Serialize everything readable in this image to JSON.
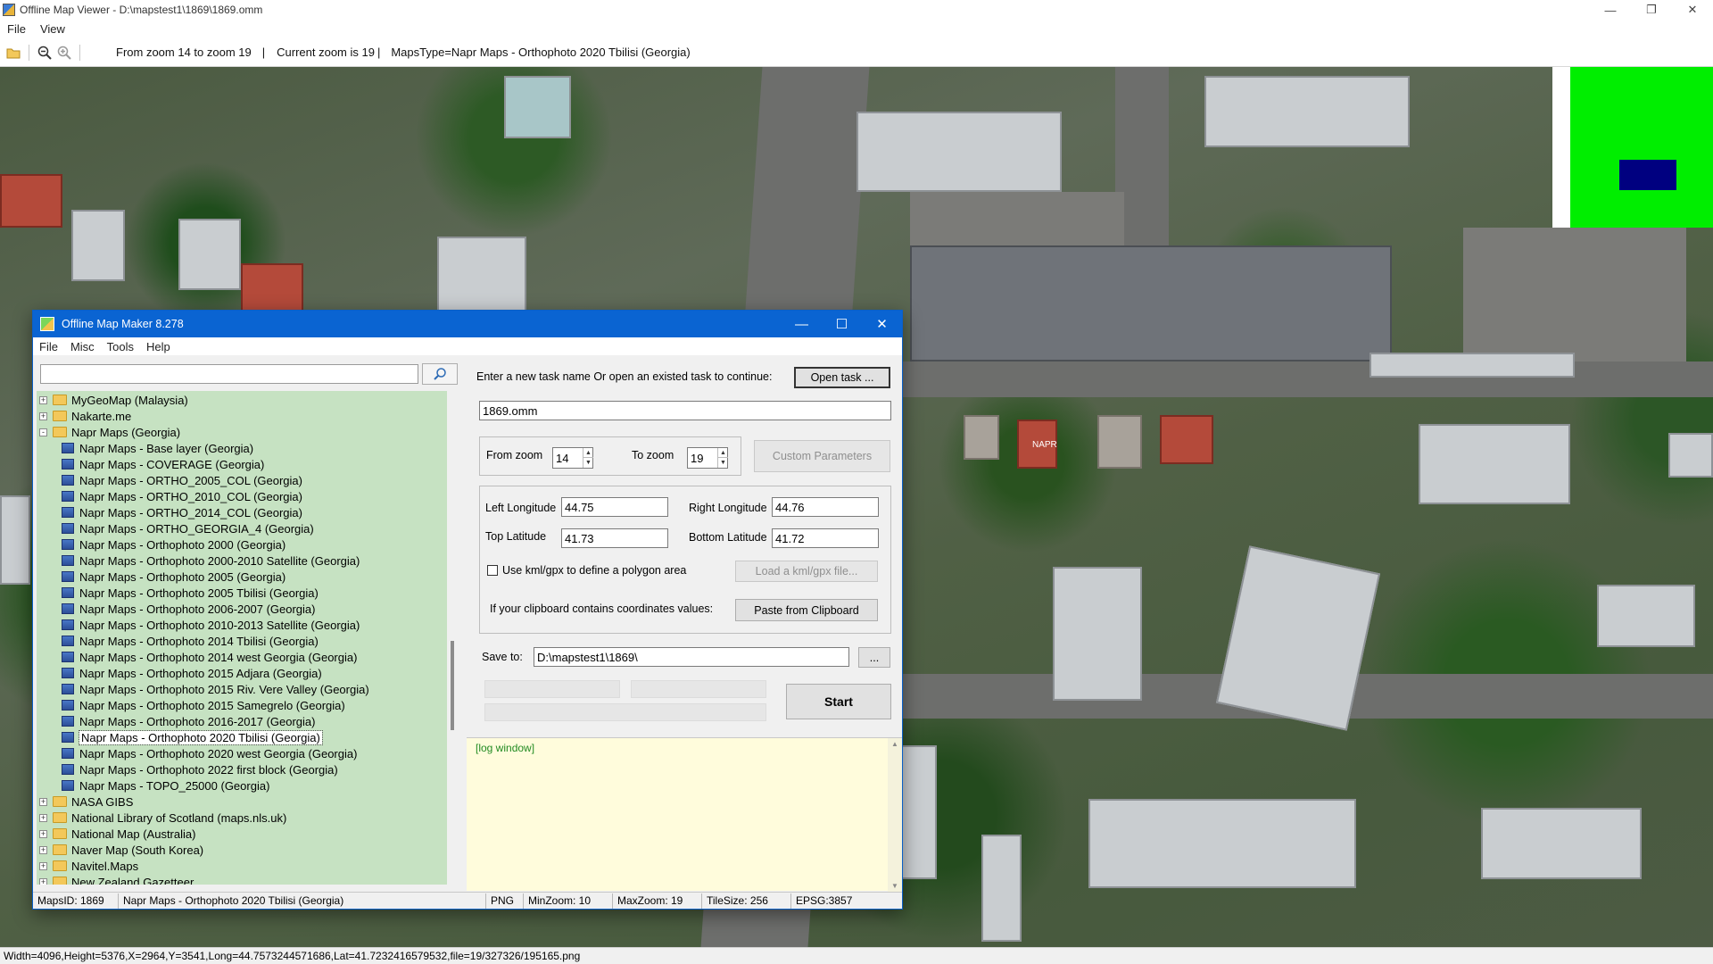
{
  "window": {
    "title": "Offline Map Viewer - D:\\mapstest1\\1869\\1869.omm",
    "menu": [
      "File",
      "View"
    ]
  },
  "toolbar": {
    "zoom_range": "From zoom 14 to zoom 19",
    "sep1": "|",
    "current_zoom": "Current zoom is 19",
    "sep2": "|",
    "maps_type": "MapsType=Napr Maps - Orthophoto 2020 Tbilisi (Georgia)"
  },
  "map": {
    "label": "NAPR"
  },
  "viewer_status": "Width=4096,Height=5376,X=2964,Y=3541,Long=44.7573244571686,Lat=41.7232416579532,file=19/327326/195165.png",
  "dialog": {
    "title": "Offline Map Maker 8.278",
    "menu": [
      "File",
      "Misc",
      "Tools",
      "Help"
    ],
    "search": {
      "value": ""
    },
    "tree": [
      {
        "level": 0,
        "type": "folder",
        "exp": "+",
        "label": "MyGeoMap (Malaysia)"
      },
      {
        "level": 0,
        "type": "folder",
        "exp": "+",
        "label": "Nakarte.me"
      },
      {
        "level": 0,
        "type": "folder",
        "exp": "-",
        "label": "Napr Maps (Georgia)"
      },
      {
        "level": 1,
        "type": "map",
        "label": "Napr Maps - Base layer (Georgia)"
      },
      {
        "level": 1,
        "type": "map",
        "label": "Napr Maps - COVERAGE (Georgia)"
      },
      {
        "level": 1,
        "type": "map",
        "label": "Napr Maps - ORTHO_2005_COL (Georgia)"
      },
      {
        "level": 1,
        "type": "map",
        "label": "Napr Maps - ORTHO_2010_COL (Georgia)"
      },
      {
        "level": 1,
        "type": "map",
        "label": "Napr Maps - ORTHO_2014_COL (Georgia)"
      },
      {
        "level": 1,
        "type": "map",
        "label": "Napr Maps - ORTHO_GEORGIA_4 (Georgia)"
      },
      {
        "level": 1,
        "type": "map",
        "label": "Napr Maps - Orthophoto 2000 (Georgia)"
      },
      {
        "level": 1,
        "type": "map",
        "label": "Napr Maps - Orthophoto 2000-2010 Satellite (Georgia)"
      },
      {
        "level": 1,
        "type": "map",
        "label": "Napr Maps - Orthophoto 2005 (Georgia)"
      },
      {
        "level": 1,
        "type": "map",
        "label": "Napr Maps - Orthophoto 2005 Tbilisi (Georgia)"
      },
      {
        "level": 1,
        "type": "map",
        "label": "Napr Maps - Orthophoto 2006-2007 (Georgia)"
      },
      {
        "level": 1,
        "type": "map",
        "label": "Napr Maps - Orthophoto 2010-2013 Satellite (Georgia)"
      },
      {
        "level": 1,
        "type": "map",
        "label": "Napr Maps - Orthophoto 2014 Tbilisi (Georgia)"
      },
      {
        "level": 1,
        "type": "map",
        "label": "Napr Maps - Orthophoto 2014 west Georgia (Georgia)"
      },
      {
        "level": 1,
        "type": "map",
        "label": "Napr Maps - Orthophoto 2015 Adjara (Georgia)"
      },
      {
        "level": 1,
        "type": "map",
        "label": "Napr Maps - Orthophoto 2015 Riv. Vere Valley (Georgia)"
      },
      {
        "level": 1,
        "type": "map",
        "label": "Napr Maps - Orthophoto 2015 Samegrelo (Georgia)"
      },
      {
        "level": 1,
        "type": "map",
        "label": "Napr Maps - Orthophoto 2016-2017 (Georgia)"
      },
      {
        "level": 1,
        "type": "map",
        "label": "Napr Maps - Orthophoto 2020 Tbilisi (Georgia)",
        "selected": true
      },
      {
        "level": 1,
        "type": "map",
        "label": "Napr Maps - Orthophoto 2020 west Georgia (Georgia)"
      },
      {
        "level": 1,
        "type": "map",
        "label": "Napr Maps - Orthophoto 2022 first block (Georgia)"
      },
      {
        "level": 1,
        "type": "map",
        "label": "Napr Maps - TOPO_25000 (Georgia)"
      },
      {
        "level": 0,
        "type": "folder",
        "exp": "+",
        "label": "NASA GIBS"
      },
      {
        "level": 0,
        "type": "folder",
        "exp": "+",
        "label": "National Library of Scotland (maps.nls.uk)"
      },
      {
        "level": 0,
        "type": "folder",
        "exp": "+",
        "label": "National Map (Australia)"
      },
      {
        "level": 0,
        "type": "folder",
        "exp": "+",
        "label": "Naver Map (South Korea)"
      },
      {
        "level": 0,
        "type": "folder",
        "exp": "+",
        "label": "Navitel.Maps"
      },
      {
        "level": 0,
        "type": "folder",
        "exp": "+",
        "label": "New Zealand Gazetteer"
      }
    ],
    "task_prompt": "Enter a new task name Or open an existed task to continue:",
    "open_task": "Open task ...",
    "task_name": "1869.omm",
    "from_zoom_label": "From zoom",
    "from_zoom": "14",
    "to_zoom_label": "To zoom",
    "to_zoom": "19",
    "custom_params": "Custom Parameters",
    "left_lon_label": "Left Longitude",
    "left_lon": "44.75",
    "right_lon_label": "Right Longitude",
    "right_lon": "44.76",
    "top_lat_label": "Top Latitude",
    "top_lat": "41.73",
    "bottom_lat_label": "Bottom Latitude",
    "bottom_lat": "41.72",
    "kml_label": "Use kml/gpx to define a polygon area",
    "load_kml": "Load a kml/gpx file...",
    "clipboard_prompt": "If your clipboard contains coordinates values:",
    "paste_clipboard": "Paste from Clipboard",
    "save_to_label": "Save to:",
    "save_to": "D:\\mapstest1\\1869\\",
    "browse": "...",
    "start": "Start",
    "log": "[log window]",
    "status": {
      "maps_id": "MapsID: 1869",
      "maps_name": "Napr Maps - Orthophoto 2020 Tbilisi (Georgia)",
      "format": "PNG",
      "min_zoom": "MinZoom: 10",
      "max_zoom": "MaxZoom: 19",
      "tile_size": "TileSize: 256",
      "epsg": "EPSG:3857"
    }
  }
}
